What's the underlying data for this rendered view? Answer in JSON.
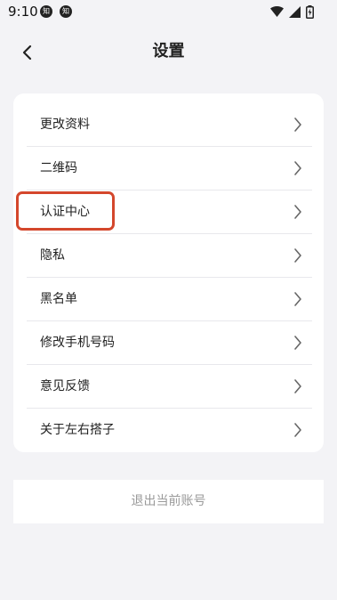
{
  "status_bar": {
    "time": "9:10",
    "notifications": [
      "知",
      "知"
    ],
    "icons": [
      "wifi-icon",
      "signal-icon",
      "battery-charging-icon"
    ]
  },
  "header": {
    "back_icon": "chevron-left-icon",
    "title": "设置"
  },
  "settings": {
    "items": [
      {
        "label": "更改资料"
      },
      {
        "label": "二维码"
      },
      {
        "label": "认证中心",
        "highlighted": true
      },
      {
        "label": "隐私"
      },
      {
        "label": "黑名单"
      },
      {
        "label": "修改手机号码"
      },
      {
        "label": "意见反馈"
      },
      {
        "label": "关于左右搭子"
      }
    ],
    "item_icon": "chevron-right-icon"
  },
  "logout": {
    "label": "退出当前账号"
  },
  "colors": {
    "background": "#f3f3f6",
    "card": "#ffffff",
    "highlight": "#d4472c",
    "muted_text": "#9a9a9a"
  }
}
